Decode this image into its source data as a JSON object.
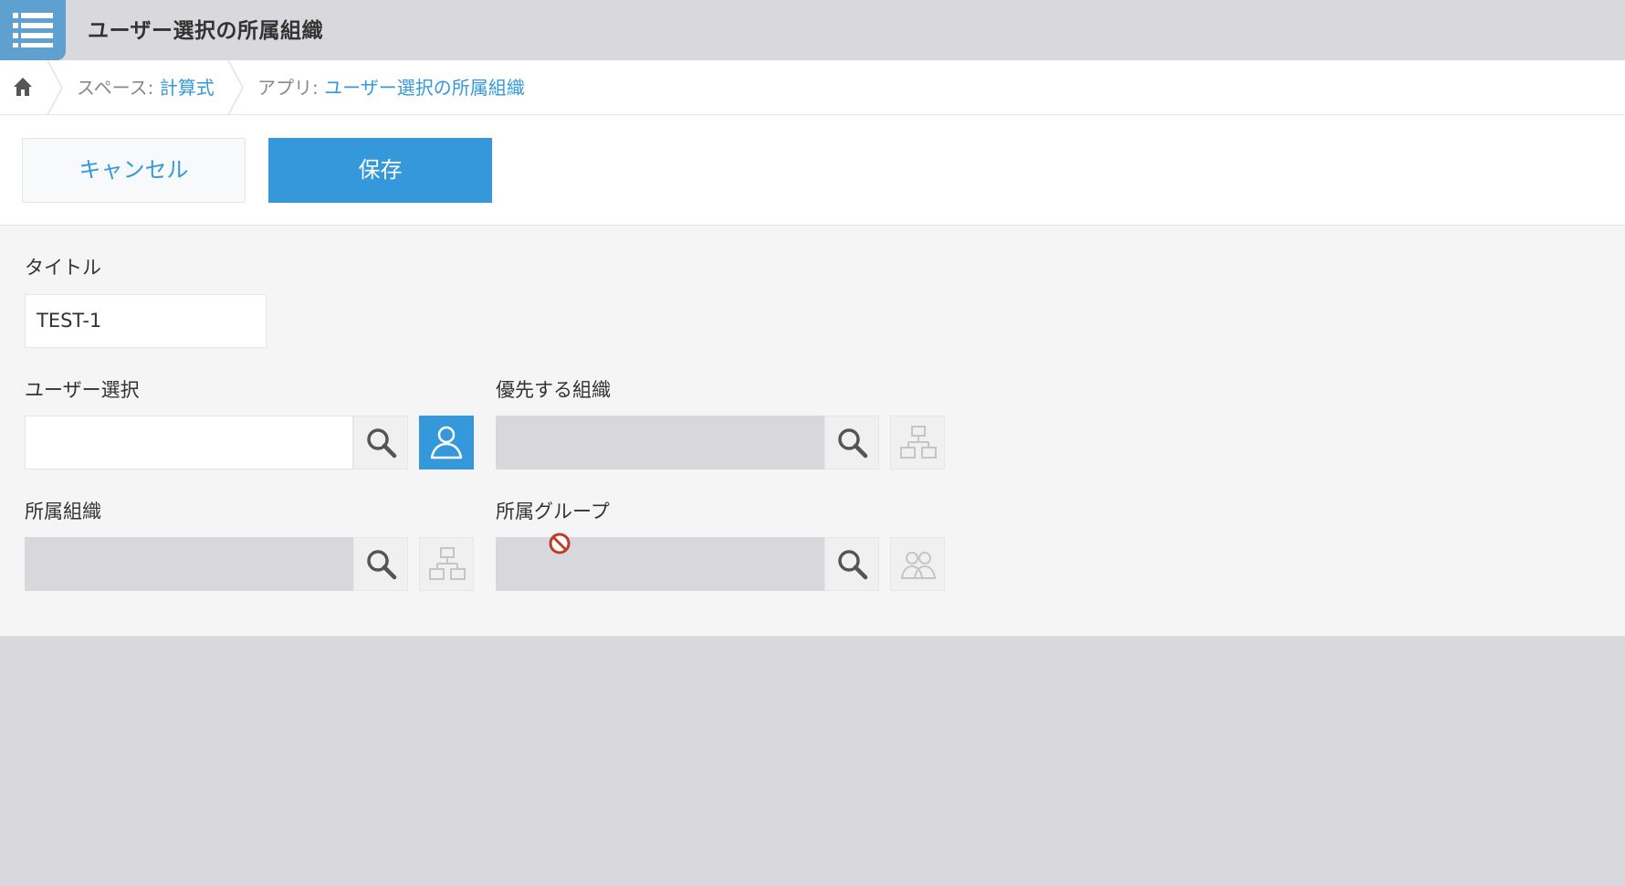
{
  "header": {
    "app_icon": "list-icon",
    "title": "ユーザー選択の所属組織"
  },
  "breadcrumb": {
    "home_icon": "home-icon",
    "space_prefix": "スペース: ",
    "space_name": "計算式",
    "app_prefix": "アプリ: ",
    "app_name": "ユーザー選択の所属組織"
  },
  "toolbar": {
    "cancel_label": "キャンセル",
    "save_label": "保存"
  },
  "form": {
    "title_field": {
      "label": "タイトル",
      "value": "TEST-1"
    },
    "user_select": {
      "label": "ユーザー選択",
      "value": "",
      "picker_icon": "user-icon",
      "search_icon": "search-icon"
    },
    "priority_org": {
      "label": "優先する組織",
      "value": "",
      "picker_icon": "org-chart-icon",
      "search_icon": "search-icon"
    },
    "org": {
      "label": "所属組織",
      "value": "",
      "picker_icon": "org-chart-icon",
      "search_icon": "search-icon"
    },
    "group": {
      "label": "所属グループ",
      "value": "",
      "picker_icon": "group-icon",
      "search_icon": "search-icon"
    }
  },
  "colors": {
    "accent": "#3498db",
    "app_icon_bg": "#5ea1d0",
    "header_bg": "#d9d8dd",
    "disabled_field": "#d8d8dc"
  }
}
